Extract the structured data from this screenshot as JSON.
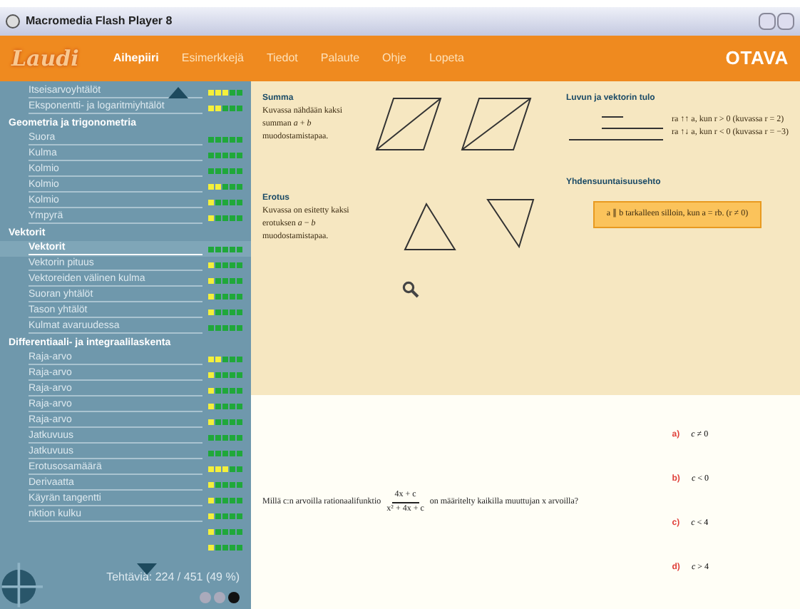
{
  "window": {
    "title": "Macromedia Flash Player 8"
  },
  "nav": {
    "logo": "Laudi",
    "items": [
      {
        "label": "Aihepiiri",
        "selected": true
      },
      {
        "label": "Esimerkkejä",
        "selected": false
      },
      {
        "label": "Tiedot",
        "selected": false
      },
      {
        "label": "Palaute",
        "selected": false
      },
      {
        "label": "Ohje",
        "selected": false
      },
      {
        "label": "Lopeta",
        "selected": false
      }
    ],
    "brand": "OTAVA"
  },
  "sidebar": {
    "items": [
      {
        "kind": "topic",
        "label": "Itseisarvoyhtälöt",
        "dots": [
          {
            "color": "#f4f03a"
          },
          {
            "color": "#f4f03a"
          },
          {
            "color": "#f4f03a"
          },
          {
            "color": "#1fa83a"
          },
          {
            "color": "#1fa83a"
          }
        ],
        "selected": false
      },
      {
        "kind": "topic",
        "label": "Eksponentti- ja logaritmiyhtälöt",
        "dots": [
          {
            "color": "#f4f03a"
          },
          {
            "color": "#f4f03a"
          },
          {
            "color": "#1fa83a"
          },
          {
            "color": "#1fa83a"
          },
          {
            "color": "#1fa83a"
          }
        ],
        "selected": false
      },
      {
        "kind": "heading",
        "label": "Geometria ja trigonometria"
      },
      {
        "kind": "topic",
        "label": "Suora",
        "dots": [
          {
            "color": "#1fa83a"
          },
          {
            "color": "#1fa83a"
          },
          {
            "color": "#1fa83a"
          },
          {
            "color": "#1fa83a"
          },
          {
            "color": "#1fa83a"
          }
        ],
        "selected": false
      },
      {
        "kind": "topic",
        "label": "Kulma",
        "dots": [
          {
            "color": "#1fa83a"
          },
          {
            "color": "#1fa83a"
          },
          {
            "color": "#1fa83a"
          },
          {
            "color": "#1fa83a"
          },
          {
            "color": "#1fa83a"
          }
        ],
        "selected": false
      },
      {
        "kind": "topic",
        "label": "Kolmio",
        "dots": [
          {
            "color": "#1fa83a"
          },
          {
            "color": "#1fa83a"
          },
          {
            "color": "#1fa83a"
          },
          {
            "color": "#1fa83a"
          },
          {
            "color": "#1fa83a"
          }
        ],
        "selected": false
      },
      {
        "kind": "topic",
        "label": "Kolmio",
        "dots": [
          {
            "color": "#f4f03a"
          },
          {
            "color": "#f4f03a"
          },
          {
            "color": "#1fa83a"
          },
          {
            "color": "#1fa83a"
          },
          {
            "color": "#1fa83a"
          }
        ],
        "selected": false
      },
      {
        "kind": "topic",
        "label": "Kolmio",
        "dots": [
          {
            "color": "#f4f03a"
          },
          {
            "color": "#1fa83a"
          },
          {
            "color": "#1fa83a"
          },
          {
            "color": "#1fa83a"
          },
          {
            "color": "#1fa83a"
          }
        ],
        "selected": false
      },
      {
        "kind": "topic",
        "label": "Ympyrä",
        "dots": [
          {
            "color": "#f4f03a"
          },
          {
            "color": "#1fa83a"
          },
          {
            "color": "#1fa83a"
          },
          {
            "color": "#1fa83a"
          },
          {
            "color": "#1fa83a"
          }
        ],
        "selected": false
      },
      {
        "kind": "heading",
        "label": "Vektorit"
      },
      {
        "kind": "topic",
        "label": "Vektorit",
        "dots": [
          {
            "color": "#1fa83a"
          },
          {
            "color": "#1fa83a"
          },
          {
            "color": "#1fa83a"
          },
          {
            "color": "#1fa83a"
          },
          {
            "color": "#1fa83a"
          }
        ],
        "selected": true
      },
      {
        "kind": "topic",
        "label": "Vektorin pituus",
        "dots": [
          {
            "color": "#f4f03a"
          },
          {
            "color": "#1fa83a"
          },
          {
            "color": "#1fa83a"
          },
          {
            "color": "#1fa83a"
          },
          {
            "color": "#1fa83a"
          }
        ],
        "selected": false
      },
      {
        "kind": "topic",
        "label": "Vektoreiden välinen kulma",
        "dots": [
          {
            "color": "#f4f03a"
          },
          {
            "color": "#1fa83a"
          },
          {
            "color": "#1fa83a"
          },
          {
            "color": "#1fa83a"
          },
          {
            "color": "#1fa83a"
          }
        ],
        "selected": false
      },
      {
        "kind": "topic",
        "label": "Suoran yhtälöt",
        "dots": [
          {
            "color": "#f4f03a"
          },
          {
            "color": "#1fa83a"
          },
          {
            "color": "#1fa83a"
          },
          {
            "color": "#1fa83a"
          },
          {
            "color": "#1fa83a"
          }
        ],
        "selected": false
      },
      {
        "kind": "topic",
        "label": "Tason yhtälöt",
        "dots": [
          {
            "color": "#f4f03a"
          },
          {
            "color": "#1fa83a"
          },
          {
            "color": "#1fa83a"
          },
          {
            "color": "#1fa83a"
          },
          {
            "color": "#1fa83a"
          }
        ],
        "selected": false
      },
      {
        "kind": "topic",
        "label": "Kulmat avaruudessa",
        "dots": [
          {
            "color": "#1fa83a"
          },
          {
            "color": "#1fa83a"
          },
          {
            "color": "#1fa83a"
          },
          {
            "color": "#1fa83a"
          },
          {
            "color": "#1fa83a"
          }
        ],
        "selected": false
      },
      {
        "kind": "heading",
        "label": "Differentiaali- ja integraalilaskenta"
      },
      {
        "kind": "topic",
        "label": "Raja-arvo",
        "dots": [
          {
            "color": "#f4f03a"
          },
          {
            "color": "#f4f03a"
          },
          {
            "color": "#1fa83a"
          },
          {
            "color": "#1fa83a"
          },
          {
            "color": "#1fa83a"
          }
        ],
        "selected": false
      },
      {
        "kind": "topic",
        "label": "Raja-arvo",
        "dots": [
          {
            "color": "#f4f03a"
          },
          {
            "color": "#1fa83a"
          },
          {
            "color": "#1fa83a"
          },
          {
            "color": "#1fa83a"
          },
          {
            "color": "#1fa83a"
          }
        ],
        "selected": false
      },
      {
        "kind": "topic",
        "label": "Raja-arvo",
        "dots": [
          {
            "color": "#f4f03a"
          },
          {
            "color": "#1fa83a"
          },
          {
            "color": "#1fa83a"
          },
          {
            "color": "#1fa83a"
          },
          {
            "color": "#1fa83a"
          }
        ],
        "selected": false
      },
      {
        "kind": "topic",
        "label": "Raja-arvo",
        "dots": [
          {
            "color": "#f4f03a"
          },
          {
            "color": "#1fa83a"
          },
          {
            "color": "#1fa83a"
          },
          {
            "color": "#1fa83a"
          },
          {
            "color": "#1fa83a"
          }
        ],
        "selected": false
      },
      {
        "kind": "topic",
        "label": "Raja-arvo",
        "dots": [
          {
            "color": "#f4f03a"
          },
          {
            "color": "#1fa83a"
          },
          {
            "color": "#1fa83a"
          },
          {
            "color": "#1fa83a"
          },
          {
            "color": "#1fa83a"
          }
        ],
        "selected": false
      },
      {
        "kind": "topic",
        "label": "Jatkuvuus",
        "dots": [
          {
            "color": "#1fa83a"
          },
          {
            "color": "#1fa83a"
          },
          {
            "color": "#1fa83a"
          },
          {
            "color": "#1fa83a"
          },
          {
            "color": "#1fa83a"
          }
        ],
        "selected": false
      },
      {
        "kind": "topic",
        "label": "Jatkuvuus",
        "dots": [
          {
            "color": "#1fa83a"
          },
          {
            "color": "#1fa83a"
          },
          {
            "color": "#1fa83a"
          },
          {
            "color": "#1fa83a"
          },
          {
            "color": "#1fa83a"
          }
        ],
        "selected": false
      },
      {
        "kind": "topic",
        "label": "Erotusosamäärä",
        "dots": [
          {
            "color": "#f4f03a"
          },
          {
            "color": "#f4f03a"
          },
          {
            "color": "#f4f03a"
          },
          {
            "color": "#1fa83a"
          },
          {
            "color": "#1fa83a"
          }
        ],
        "selected": false
      },
      {
        "kind": "topic",
        "label": "Derivaatta",
        "dots": [
          {
            "color": "#f4f03a"
          },
          {
            "color": "#1fa83a"
          },
          {
            "color": "#1fa83a"
          },
          {
            "color": "#1fa83a"
          },
          {
            "color": "#1fa83a"
          }
        ],
        "selected": false
      },
      {
        "kind": "topic",
        "label": "Käyrän tangentti",
        "dots": [
          {
            "color": "#f4f03a"
          },
          {
            "color": "#1fa83a"
          },
          {
            "color": "#1fa83a"
          },
          {
            "color": "#1fa83a"
          },
          {
            "color": "#1fa83a"
          }
        ],
        "selected": false
      },
      {
        "kind": "topic",
        "label": "nktion kulku",
        "dots": [
          {
            "color": "#f4f03a"
          },
          {
            "color": "#1fa83a"
          },
          {
            "color": "#1fa83a"
          },
          {
            "color": "#1fa83a"
          },
          {
            "color": "#1fa83a"
          }
        ],
        "selected": false
      },
      {
        "kind": "topic",
        "dots": [
          {
            "color": "#f4f03a"
          },
          {
            "color": "#1fa83a"
          },
          {
            "color": "#1fa83a"
          },
          {
            "color": "#1fa83a"
          },
          {
            "color": "#1fa83a"
          }
        ],
        "selected": false
      },
      {
        "kind": "topic",
        "dots": [
          {
            "color": "#f4f03a"
          },
          {
            "color": "#1fa83a"
          },
          {
            "color": "#1fa83a"
          },
          {
            "color": "#1fa83a"
          },
          {
            "color": "#1fa83a"
          }
        ],
        "selected": false
      }
    ],
    "progress": "Tehtäviä: 224 / 451 (49 %)"
  },
  "theory": {
    "sum": {
      "title": "Summa",
      "text": "Kuvassa nähdään kaksi summan *a* + *b* muodostamistapaa."
    },
    "difference": {
      "title": "Erotus",
      "text": "Kuvassa on esitetty kaksi erotuksen *a* − *b* muodostamistapaa."
    },
    "product": {
      "title": "Luvun ja vektorin tulo",
      "lines": [
        "ra ↑↑ a, kun r > 0 (kuvassa r = 2)",
        "ra ↑↓ a, kun r < 0 (kuvassa r = −3)"
      ]
    },
    "parallel": {
      "title": "Yhdensuuntaisuusehto",
      "rule": "a ∥ b tarkalleen silloin, kun a = rb. (r ≠ 0)"
    }
  },
  "question": {
    "before": "Millä c:n arvoilla rationaalifunktio",
    "numerator": "4x + c",
    "denominator": "x² + 4x + c",
    "after": "on määritelty kaikilla muuttujan x arvoilla?",
    "options": [
      {
        "letter": "a)",
        "text": "*c* ≠ 0"
      },
      {
        "letter": "b)",
        "text": "*c* < 0"
      },
      {
        "letter": "c)",
        "text": "*c* < 4"
      },
      {
        "letter": "d)",
        "text": "*c* > 4"
      }
    ]
  }
}
